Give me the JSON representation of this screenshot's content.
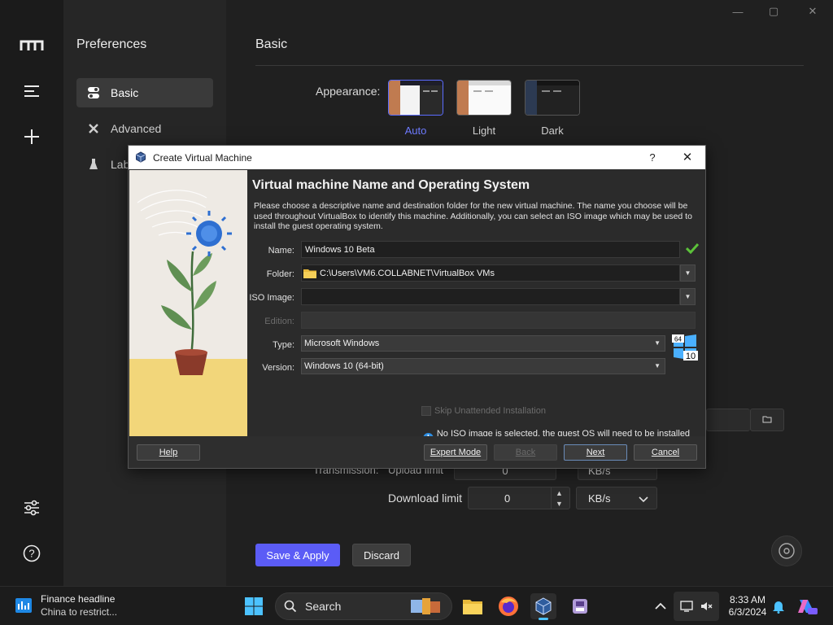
{
  "app": {
    "prefs_title": "Preferences",
    "sidebar": [
      {
        "label": "Basic",
        "icon": "toggle-icon"
      },
      {
        "label": "Advanced",
        "icon": "wrench-icon"
      },
      {
        "label": "Lab",
        "icon": "flask-icon"
      }
    ],
    "main_title": "Basic",
    "appearance_label": "Appearance:",
    "themes": [
      "Auto",
      "Light",
      "Dark"
    ],
    "transmission_label": "Transmission:",
    "upload_label": "Upload limit",
    "upload_value": "0",
    "download_label": "Download limit",
    "download_value": "0",
    "unit": "KB/s",
    "save_apply": "Save & Apply",
    "discard": "Discard"
  },
  "dialog": {
    "title": "Create Virtual Machine",
    "help_glyph": "?",
    "close_glyph": "✕",
    "heading": "Virtual machine Name and Operating System",
    "description": "Please choose a descriptive name and destination folder for the new virtual machine. The name you choose will be used throughout VirtualBox to identify this machine. Additionally, you can select an ISO image which may be used to install the guest operating system.",
    "name_label": "Name:",
    "name_value": "Windows 10 Beta",
    "folder_label": "Folder:",
    "folder_value": "C:\\Users\\VM6.COLLABNET\\VirtualBox VMs",
    "iso_label": "ISO Image:",
    "iso_value": "",
    "edition_label": "Edition:",
    "type_label": "Type:",
    "type_value": "Microsoft Windows",
    "version_label": "Version:",
    "version_value": "Windows 10 (64-bit)",
    "os_badge": {
      "bits": "64",
      "ver": "10"
    },
    "skip_label": "Skip Unattended Installation",
    "info_text": "No ISO image is selected, the guest OS will need to be installed manually.",
    "buttons": {
      "help": "Help",
      "expert": "Expert Mode",
      "back": "Back",
      "next": "Next",
      "cancel": "Cancel"
    }
  },
  "taskbar": {
    "news_title": "Finance headline",
    "news_sub": "China to restrict...",
    "search_label": "Search",
    "time": "8:33 AM",
    "date": "6/3/2024"
  },
  "colors": {
    "accent": "#5b5cf6",
    "ok_check": "#5cc23a",
    "info_blue": "#2f8fe3"
  }
}
